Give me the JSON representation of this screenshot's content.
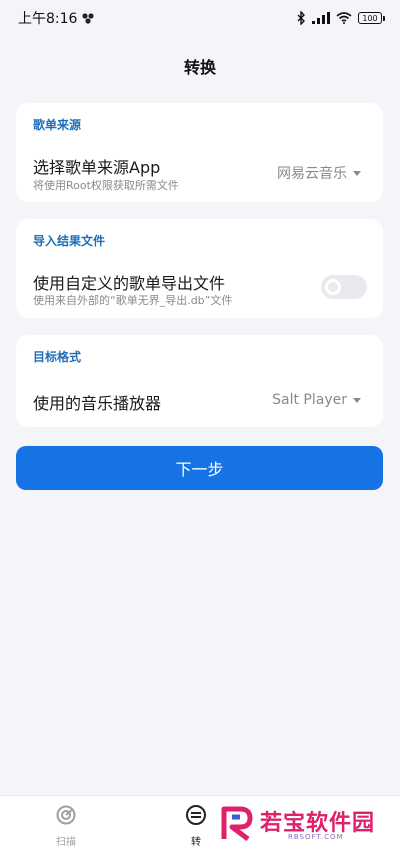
{
  "status_bar": {
    "time": "上午8:16",
    "battery": "100"
  },
  "page": {
    "title": "转换"
  },
  "source_card": {
    "header": "歌单来源",
    "row_title": "选择歌单来源App",
    "row_subtitle": "将使用Root权限获取所需文件",
    "selected_value": "网易云音乐"
  },
  "import_card": {
    "header": "导入结果文件",
    "row_title": "使用自定义的歌单导出文件",
    "row_subtitle": "使用来自外部的“歌单无界_导出.db”文件",
    "toggle_on": false
  },
  "target_card": {
    "header": "目标格式",
    "row_title": "使用的音乐播放器",
    "selected_value": "Salt Player"
  },
  "next_button": {
    "label": "下一步"
  },
  "bottom_nav": {
    "items": [
      {
        "label": "扫描",
        "icon": "scan-icon"
      },
      {
        "label": "转",
        "icon": "convert-icon"
      }
    ]
  },
  "watermark": {
    "text": "若宝软件园",
    "sub": "RBSOFT.COM"
  },
  "colors": {
    "accent": "#1673e6",
    "header": "#1f6fb8",
    "background": "#f3f5f8"
  }
}
